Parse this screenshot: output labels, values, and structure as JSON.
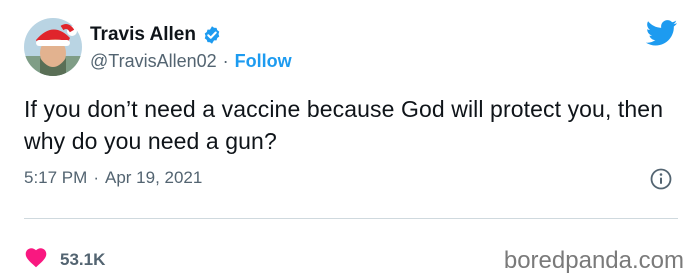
{
  "author": {
    "display_name": "Travis Allen",
    "handle": "@TravisAllen02",
    "separator": "·",
    "follow_label": "Follow",
    "verified_icon": "verified-badge-icon",
    "avatar_icon": "avatar"
  },
  "tweet": {
    "text": "If you don’t need a vaccine because God will protect you, then why do you need a gun?",
    "time": "5:17 PM",
    "separator": "·",
    "date": "Apr 19, 2021",
    "likes": "53.1K"
  },
  "icons": {
    "platform": "twitter-bird-icon",
    "info": "info-icon",
    "like": "heart-icon"
  },
  "watermark": "boredpanda.com",
  "colors": {
    "accent": "#1d9bf0",
    "text": "#0f1419",
    "secondary": "#536471",
    "like": "#f91880",
    "divider": "#cfd9de"
  }
}
